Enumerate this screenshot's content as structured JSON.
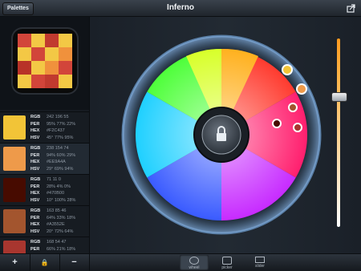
{
  "header": {
    "title": "Inferno",
    "palettes_label": "Palettes",
    "share_icon": "share-icon"
  },
  "preview": {
    "cells": [
      "#d2453a",
      "#f3c845",
      "#c13a2f",
      "#f3c845",
      "#f3c845",
      "#d2453a",
      "#f3c845",
      "#f0913c",
      "#b83228",
      "#f3c845",
      "#f0913c",
      "#d2453a",
      "#f3c845",
      "#d2453a",
      "#c13a2f",
      "#f3c845"
    ]
  },
  "colors": [
    {
      "swatch": "#f2c437",
      "rgb": "242 196 55",
      "per": "95% 77% 22%",
      "hex": "#F2C437",
      "hsv": "45° 77% 95%"
    },
    {
      "swatch": "#ee9a4a",
      "rgb": "238 154 74",
      "per": "94% 60% 29%",
      "hex": "#EE9A4A",
      "hsv": "29° 69% 94%"
    },
    {
      "swatch": "#470b00",
      "rgb": "71 11 0",
      "per": "28% 4% 0%",
      "hex": "#470B00",
      "hsv": "10° 100% 28%"
    },
    {
      "swatch": "#a3552e",
      "rgb": "163 85 46",
      "per": "64% 33% 18%",
      "hex": "#A3552E",
      "hsv": "20° 72% 64%"
    },
    {
      "swatch": "#a8362f",
      "rgb": "168 54 47",
      "per": "66% 21% 18%",
      "hex": "",
      "hsv": ""
    }
  ],
  "row_labels": {
    "rgb": "RGB",
    "per": "PER",
    "hex": "HEX",
    "hsv": "HSV"
  },
  "toolbar": {
    "add_label": "+",
    "lock_label": "🔒",
    "remove_label": "−"
  },
  "tabs": [
    {
      "label": "wheel",
      "icon": "wheel-icon",
      "active": true
    },
    {
      "label": "picker",
      "icon": "picker-icon",
      "active": false
    },
    {
      "label": "slider",
      "icon": "slider-icon",
      "active": false
    }
  ]
}
